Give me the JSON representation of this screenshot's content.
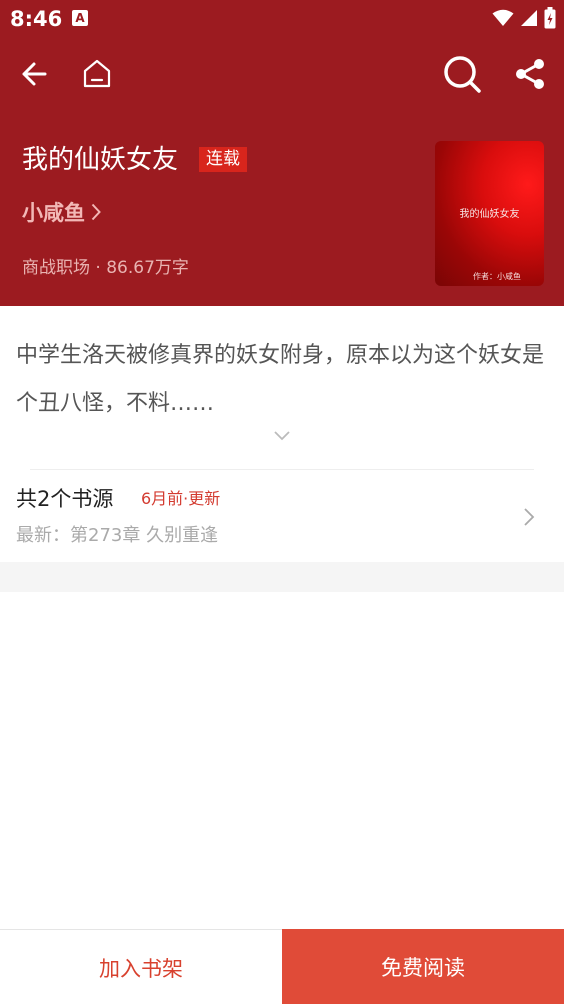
{
  "status_bar": {
    "time": "8:46",
    "notification_icon": "A",
    "icons": [
      "wifi-icon",
      "signal-icon",
      "battery-icon"
    ]
  },
  "nav": {
    "icons": [
      "back-arrow-icon",
      "home-icon",
      "search-icon",
      "share-icon"
    ]
  },
  "book": {
    "title": "我的仙妖女友",
    "status_tag": "连载",
    "author": "小咸鱼",
    "meta": "商战职场 · 86.67万字",
    "cover_title": "我的仙妖女友",
    "cover_author": "作者：小咸鱼"
  },
  "synopsis": {
    "text": "中学生洛天被修真界的妖女附身，原本以为这个妖女是个丑八怪，不料……"
  },
  "sources": {
    "count_label": "共2个书源",
    "updated": "6月前·更新",
    "latest": "最新：第273章 久别重逢"
  },
  "actions": {
    "add_to_shelf": "加入书架",
    "free_read": "免费阅读"
  },
  "colors": {
    "header_bg": "#9c1b20",
    "tag_bg": "#d8251c",
    "accent": "#e04b38"
  }
}
